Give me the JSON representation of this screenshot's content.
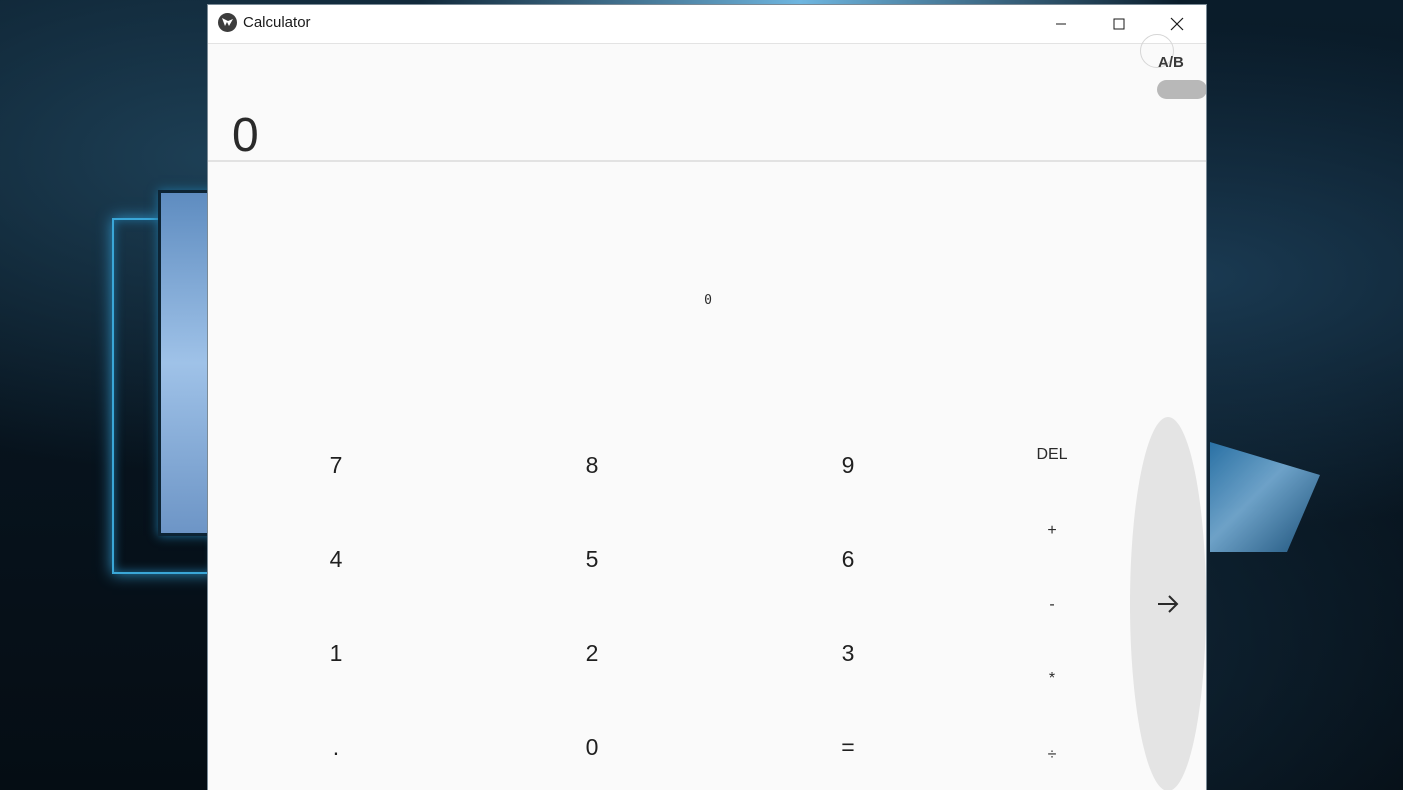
{
  "window": {
    "title": "Calculator",
    "icon": "kivy-logo-icon",
    "controls": [
      "minimize-icon",
      "maximize-icon",
      "close-icon"
    ]
  },
  "display": {
    "main_value": "0",
    "secondary_value": "0"
  },
  "mode_toggle": {
    "label": "A/B"
  },
  "keypad": {
    "digits": {
      "k7": "7",
      "k8": "8",
      "k9": "9",
      "k4": "4",
      "k5": "5",
      "k6": "6",
      "k1": "1",
      "k2": "2",
      "k3": "3",
      "dot": ".",
      "k0": "0",
      "equals": "="
    },
    "operators": {
      "del": "DEL",
      "plus": "+",
      "minus": "-",
      "multiply": "*",
      "divide": "÷"
    },
    "side_panel_icon": "arrow-right-icon"
  },
  "colors": {
    "window_bg": "#fafafa",
    "titlebar_bg": "#ffffff",
    "toggle": "#b8b8b8",
    "side_panel": "#e4e4e4",
    "text": "#1f1f1f"
  }
}
